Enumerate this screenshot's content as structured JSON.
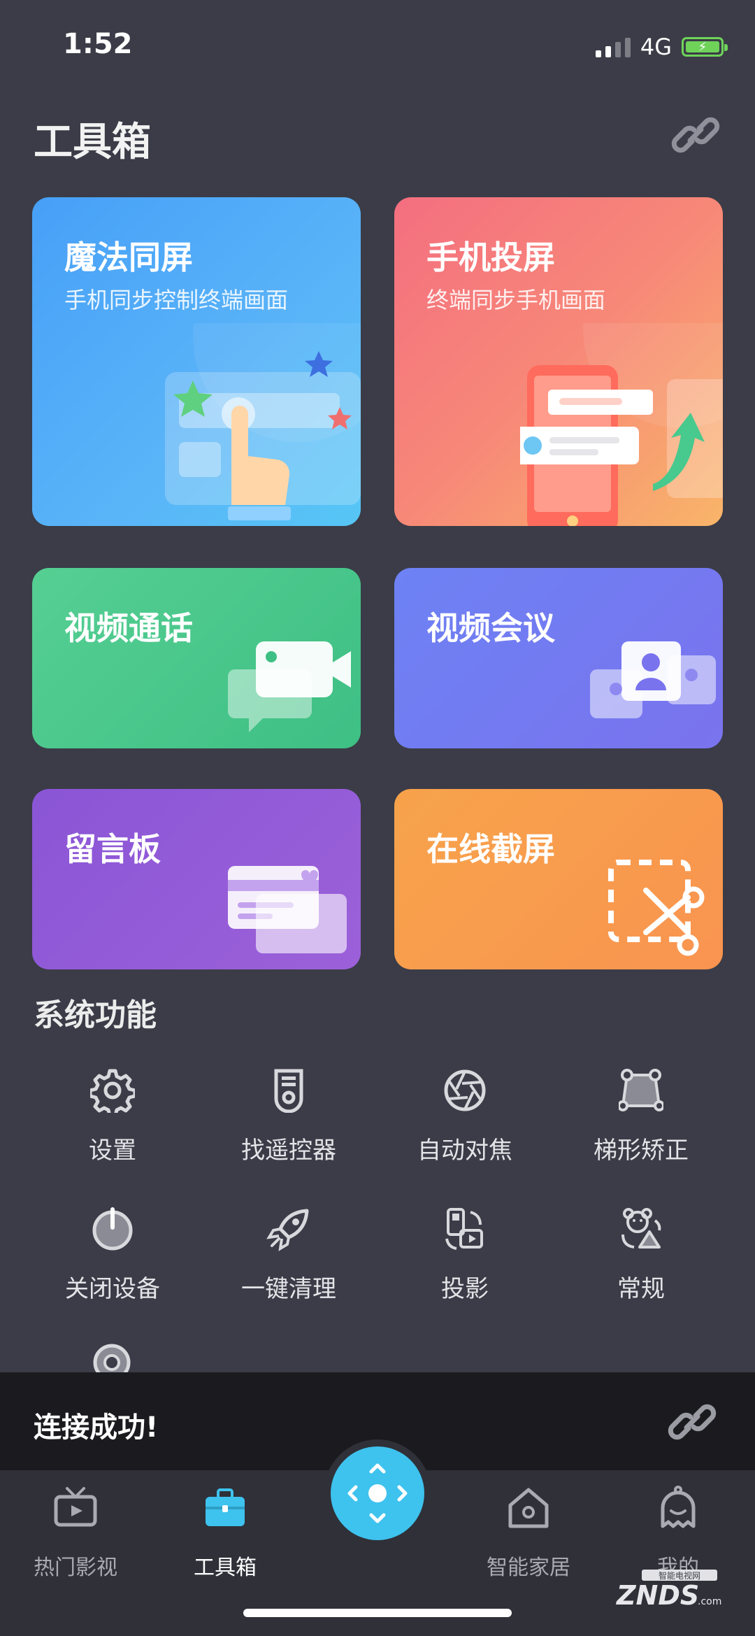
{
  "status_bar": {
    "time": "1:52",
    "network": "4G"
  },
  "header": {
    "title": "工具箱"
  },
  "cards": [
    {
      "title": "魔法同屏",
      "subtitle": "手机同步控制终端画面"
    },
    {
      "title": "手机投屏",
      "subtitle": "终端同步手机画面"
    },
    {
      "title": "视频通话"
    },
    {
      "title": "视频会议"
    },
    {
      "title": "留言板"
    },
    {
      "title": "在线截屏"
    }
  ],
  "system_section": {
    "title": "系统功能",
    "items": [
      {
        "label": "设置",
        "icon": "gear-icon"
      },
      {
        "label": "找遥控器",
        "icon": "remote-icon"
      },
      {
        "label": "自动对焦",
        "icon": "aperture-icon"
      },
      {
        "label": "梯形矫正",
        "icon": "keystone-icon"
      },
      {
        "label": "关闭设备",
        "icon": "power-icon"
      },
      {
        "label": "一键清理",
        "icon": "rocket-icon"
      },
      {
        "label": "投影",
        "icon": "projection-icon"
      },
      {
        "label": "常规",
        "icon": "bear-icon"
      }
    ]
  },
  "toast": {
    "text": "连接成功!"
  },
  "bottom_nav": {
    "items": [
      {
        "label": "热门影视",
        "icon": "tv-icon"
      },
      {
        "label": "工具箱",
        "icon": "toolbox-icon"
      },
      {
        "label": "智能家居",
        "icon": "smart-home-icon"
      },
      {
        "label": "我的",
        "icon": "ghost-icon"
      }
    ]
  },
  "watermark": {
    "text": "ZNDS",
    "sub": "智能电视网",
    "domain": ".com"
  },
  "colors": {
    "background": "#3b3c47",
    "accent": "#3ec2ee",
    "toast_bg": "#1b1b1f",
    "nav_bg": "#2f3038"
  }
}
